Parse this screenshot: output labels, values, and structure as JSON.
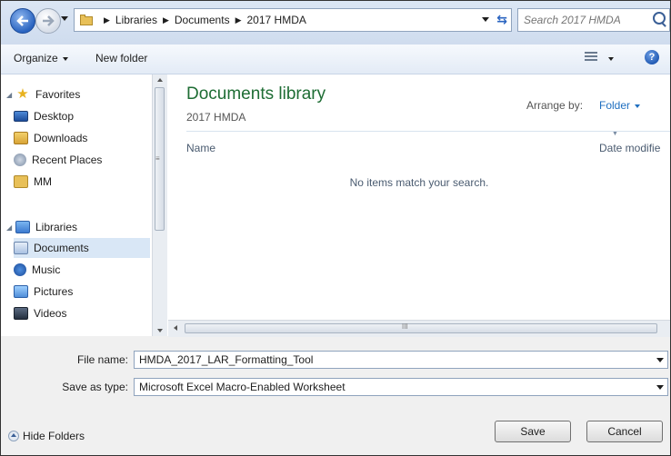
{
  "address": {
    "crumbs": [
      "Libraries",
      "Documents",
      "2017 HMDA"
    ],
    "search_placeholder": "Search 2017 HMDA"
  },
  "toolbar": {
    "organize": "Organize",
    "new_folder": "New folder"
  },
  "nav": {
    "favorites": {
      "label": "Favorites",
      "items": [
        "Desktop",
        "Downloads",
        "Recent Places",
        "MM"
      ]
    },
    "libraries": {
      "label": "Libraries",
      "items": [
        "Documents",
        "Music",
        "Pictures",
        "Videos"
      ],
      "selected": "Documents"
    }
  },
  "content": {
    "title": "Documents library",
    "subtitle": "2017 HMDA",
    "arrange_label": "Arrange by:",
    "arrange_value": "Folder",
    "col_name": "Name",
    "col_date": "Date modifie",
    "empty_message": "No items match your search."
  },
  "form": {
    "file_name_label": "File name:",
    "file_name_value": "HMDA_2017_LAR_Formatting_Tool",
    "save_type_label": "Save as type:",
    "save_type_value": "Microsoft Excel Macro-Enabled Worksheet"
  },
  "footer": {
    "hide_folders": "Hide Folders",
    "save": "Save",
    "cancel": "Cancel"
  },
  "colors": {
    "title_green": "#1e6d34",
    "link_blue": "#1f6fc0",
    "selection": "#d9e7f6"
  }
}
